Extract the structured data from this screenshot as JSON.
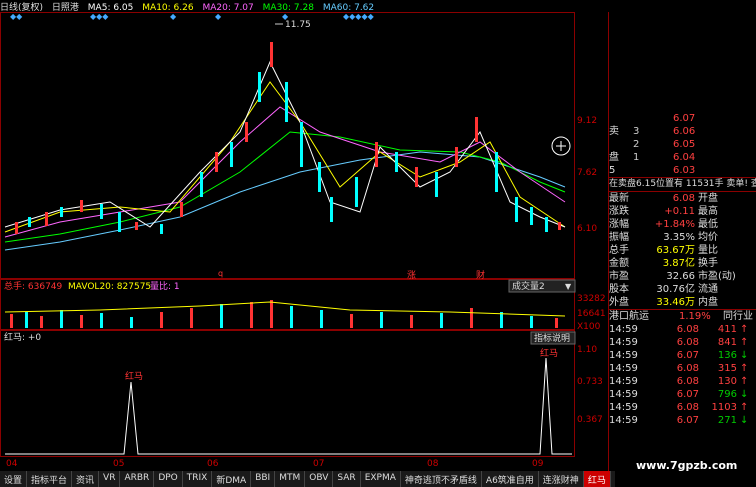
{
  "header": {
    "period": "日线(复权)",
    "indicator": "日照港",
    "ma": [
      {
        "label": "MA5: 6.05",
        "color": "#ffffff"
      },
      {
        "label": "MA10: 6.26",
        "color": "#ffff00"
      },
      {
        "label": "MA20: 7.07",
        "color": "#ff66ff"
      },
      {
        "label": "MA30: 7.28",
        "color": "#00ff00"
      },
      {
        "label": "MA60: 7.62",
        "color": "#66ccff"
      }
    ]
  },
  "price_chart": {
    "high_label": "11.75",
    "yticks": [
      "9.12",
      "7.62",
      "6.10"
    ],
    "markers": [
      "q",
      "涨",
      "财"
    ]
  },
  "volume_panel": {
    "label_total": "总手: 636749",
    "label_mavol": "MAVOL20: 827575",
    "label_ratio": "量比: 1",
    "dropdown": "成交量2",
    "yticks": [
      "33282",
      "16641",
      "X100"
    ]
  },
  "hongma_panel": {
    "title": "红马: +0",
    "button": "指标说明",
    "peak_label": "红马",
    "yticks": [
      "1.10",
      "0.733",
      "0.367"
    ]
  },
  "x_axis": [
    "04",
    "05",
    "06",
    "07",
    "08",
    "09"
  ],
  "tabs": [
    "设置",
    "指标平台",
    "资讯",
    "VR",
    "ARBR",
    "DPO",
    "TRIX",
    "新DMA",
    "BBI",
    "MTM",
    "OBV",
    "SAR",
    "EXPMA",
    "神奇逃顶不矛盾线",
    "A6筑准自用",
    "连涨财神",
    "红马"
  ],
  "active_tab": "红马",
  "order_book": {
    "sell": [
      {
        "label": "",
        "price": "6.07"
      },
      {
        "label": "卖",
        "price": "6.06"
      },
      {
        "label": "",
        "price": "6.05"
      },
      {
        "label": "盘",
        "price": "6.04"
      },
      {
        "label": "5",
        "price": "6.03"
      }
    ],
    "sell_nums": [
      "3",
      "2",
      "1"
    ]
  },
  "ask_line": "在卖盘6.15位置有 11531手 卖单! 查",
  "quote": [
    {
      "l": "最新",
      "v": "6.08",
      "r": "开盘"
    },
    {
      "l": "涨跌",
      "v": "+0.11",
      "r": "最高"
    },
    {
      "l": "涨幅",
      "v": "+1.84%",
      "r": "最低"
    },
    {
      "l": "振幅",
      "v": "3.35%",
      "r": "均价"
    },
    {
      "l": "总手",
      "v": "63.67万",
      "r": "量比"
    },
    {
      "l": "金额",
      "v": "3.87亿",
      "r": "换手"
    },
    {
      "l": "市盈",
      "v": "32.66",
      "r": "市盈(动)"
    },
    {
      "l": "股本",
      "v": "30.76亿",
      "r": "流通"
    },
    {
      "l": "外盘",
      "v": "33.46万",
      "r": "内盘"
    }
  ],
  "sector": {
    "name": "港口航运",
    "pct": "1.19%",
    "right": "同行业"
  },
  "ticks": [
    {
      "t": "14:59",
      "p": "6.08",
      "v": "411",
      "d": "up"
    },
    {
      "t": "14:59",
      "p": "6.08",
      "v": "841",
      "d": "up"
    },
    {
      "t": "14:59",
      "p": "6.07",
      "v": "136",
      "d": "down"
    },
    {
      "t": "14:59",
      "p": "6.08",
      "v": "315",
      "d": "up"
    },
    {
      "t": "14:59",
      "p": "6.08",
      "v": "130",
      "d": "up"
    },
    {
      "t": "14:59",
      "p": "6.07",
      "v": "796",
      "d": "down"
    },
    {
      "t": "14:59",
      "p": "6.08",
      "v": "1103",
      "d": "up"
    },
    {
      "t": "14:59",
      "p": "6.07",
      "v": "271",
      "d": "down"
    }
  ],
  "watermark": "www.7gpzb.com"
}
